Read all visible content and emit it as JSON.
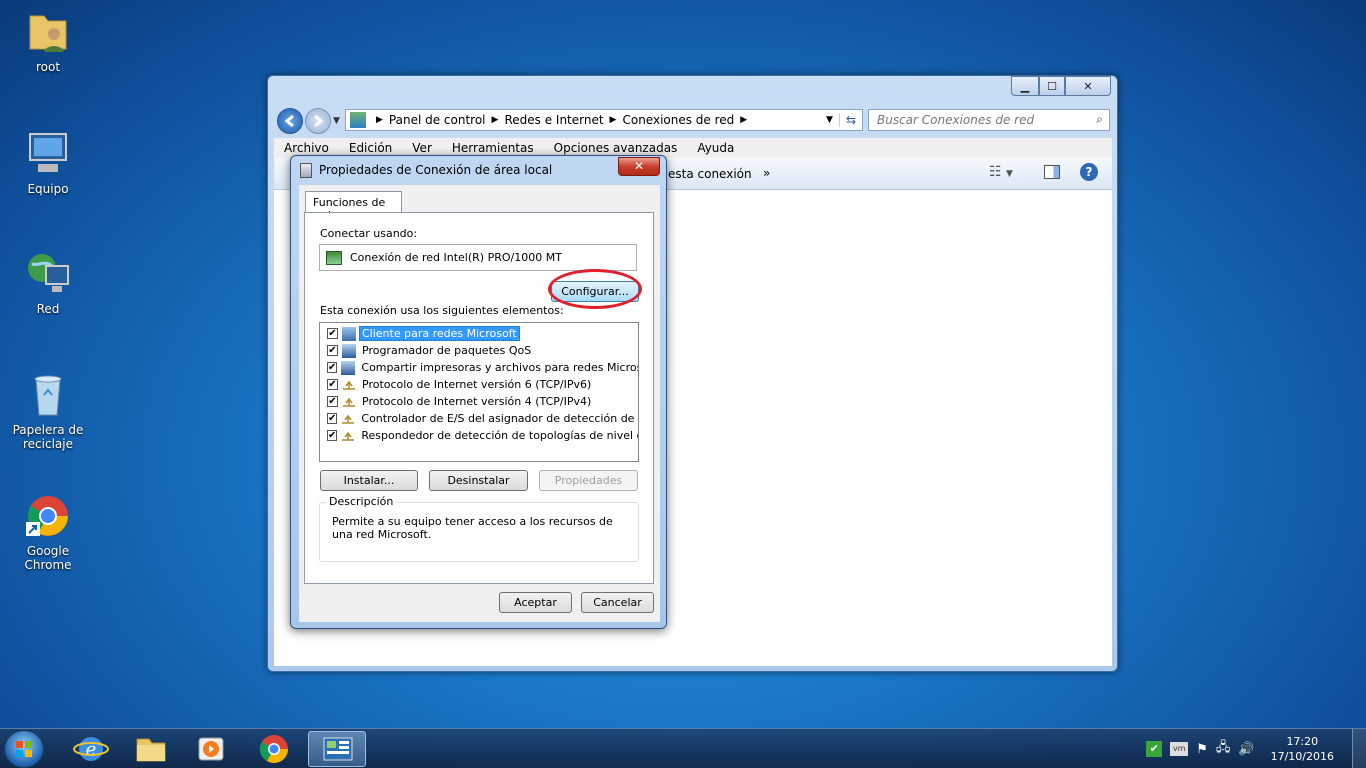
{
  "desktop": {
    "icons": [
      {
        "label": "root",
        "icon": "user-folder-icon"
      },
      {
        "label": "Equipo",
        "icon": "computer-icon"
      },
      {
        "label": "Red",
        "icon": "network-icon"
      },
      {
        "label": "Papelera de reciclaje",
        "icon": "recycle-bin-icon"
      },
      {
        "label": "Google Chrome",
        "icon": "chrome-icon"
      }
    ]
  },
  "explorer": {
    "breadcrumb": [
      "Panel de control",
      "Redes e Internet",
      "Conexiones de red"
    ],
    "search_placeholder": "Buscar Conexiones de red",
    "menu": [
      "Archivo",
      "Edición",
      "Ver",
      "Herramientas",
      "Opciones avanzadas",
      "Ayuda"
    ],
    "cmd_partial": "esta conexión",
    "cmd_more": "»"
  },
  "dialog": {
    "title": "Propiedades de Conexión de área local",
    "close": "✕",
    "tab": "Funciones de red",
    "connect_using_label": "Conectar usando:",
    "adapter": "Conexión de red Intel(R) PRO/1000 MT",
    "configure_button": "Configurar...",
    "items_label": "Esta conexión usa los siguientes elementos:",
    "items": [
      {
        "label": "Cliente para redes Microsoft",
        "checked": true,
        "selected": true
      },
      {
        "label": "Programador de paquetes QoS",
        "checked": true
      },
      {
        "label": "Compartir impresoras y archivos para redes Microsoft",
        "checked": true
      },
      {
        "label": "Protocolo de Internet versión 6 (TCP/IPv6)",
        "checked": true
      },
      {
        "label": "Protocolo de Internet versión 4 (TCP/IPv4)",
        "checked": true
      },
      {
        "label": "Controlador de E/S del asignador de detección de topol...",
        "checked": true
      },
      {
        "label": "Respondedor de detección de topologías de nivel de v...",
        "checked": true
      }
    ],
    "install_button": "Instalar...",
    "uninstall_button": "Desinstalar",
    "properties_button": "Propiedades",
    "description_legend": "Descripción",
    "description_text": "Permite a su equipo tener acceso a los recursos de una red Microsoft.",
    "ok_button": "Aceptar",
    "cancel_button": "Cancelar"
  },
  "taskbar": {
    "time": "17:20",
    "date": "17/10/2016"
  }
}
